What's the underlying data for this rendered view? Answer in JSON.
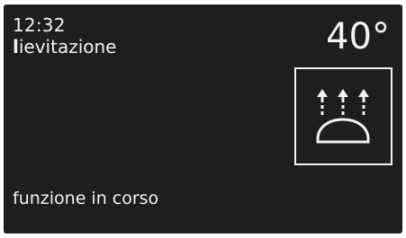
{
  "display": {
    "time": "12:32",
    "mode_first_letter": "l",
    "mode_rest": "ievitazione",
    "temperature": "40°",
    "function_icon": "dough-rising-icon",
    "status": "funzione in corso"
  },
  "colors": {
    "screen_background": "#1e1e1e",
    "foreground": "#f2f2f2"
  }
}
